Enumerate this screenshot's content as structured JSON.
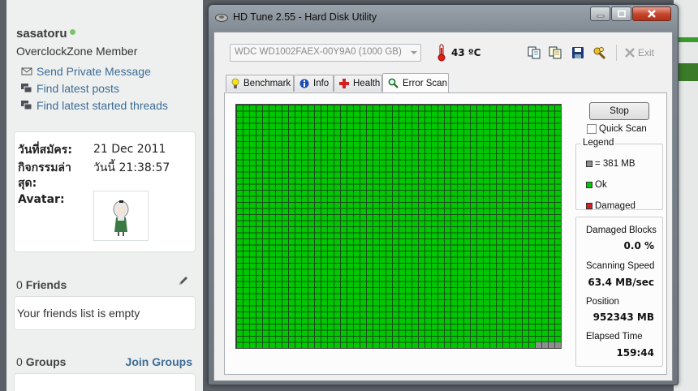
{
  "forum": {
    "username": "sasatoru",
    "user_title": "OverclockZone Member",
    "links": [
      {
        "label": "Send Private Message",
        "icon": "envelope-icon"
      },
      {
        "label": "Find latest posts",
        "icon": "posts-icon"
      },
      {
        "label": "Find latest started threads",
        "icon": "threads-icon"
      }
    ],
    "info": {
      "join_label": "วันที่สมัคร:",
      "join_value": "21 Dec 2011",
      "activity_label_1": "กิจกรรมล่า",
      "activity_label_2": "สุด:",
      "activity_value": "วันนี้ 21:38:57",
      "avatar_label": "Avatar:"
    },
    "friends": {
      "count": "0",
      "label": "Friends",
      "empty_text": "Your friends list is empty"
    },
    "groups": {
      "count": "0",
      "label": "Groups",
      "join_label": "Join Groups"
    }
  },
  "app": {
    "title": "HD Tune 2.55 - Hard Disk Utility",
    "drive": "WDC WD1002FAEX-00Y9A0 (1000 GB)",
    "temperature": "43 ºC",
    "exit_label": "Exit",
    "tabs": [
      {
        "label": "Benchmark",
        "icon": "bulb-icon"
      },
      {
        "label": "Info",
        "icon": "info-icon"
      },
      {
        "label": "Health",
        "icon": "health-cross-icon"
      },
      {
        "label": "Error Scan",
        "icon": "magnifier-icon"
      }
    ],
    "active_tab": "Error Scan",
    "stop_label": "Stop",
    "quick_scan_label": "Quick Scan",
    "legend": {
      "title": "Legend",
      "items": [
        {
          "label": "= 381 MB",
          "color": "#8e8e8e"
        },
        {
          "label": "Ok",
          "color": "#00c800"
        },
        {
          "label": "Damaged",
          "color": "#d42020"
        }
      ]
    },
    "stats": {
      "damaged_blocks_label": "Damaged Blocks",
      "damaged_blocks_value": "0.0 %",
      "scanning_speed_label": "Scanning Speed",
      "scanning_speed_value": "63.4 MB/sec",
      "position_label": "Position",
      "position_value": "952343 MB",
      "elapsed_label": "Elapsed Time",
      "elapsed_value": "159:44"
    },
    "colors": {
      "ok": "#00c800",
      "damaged": "#d42020",
      "pending": "#8e8e8e"
    }
  }
}
